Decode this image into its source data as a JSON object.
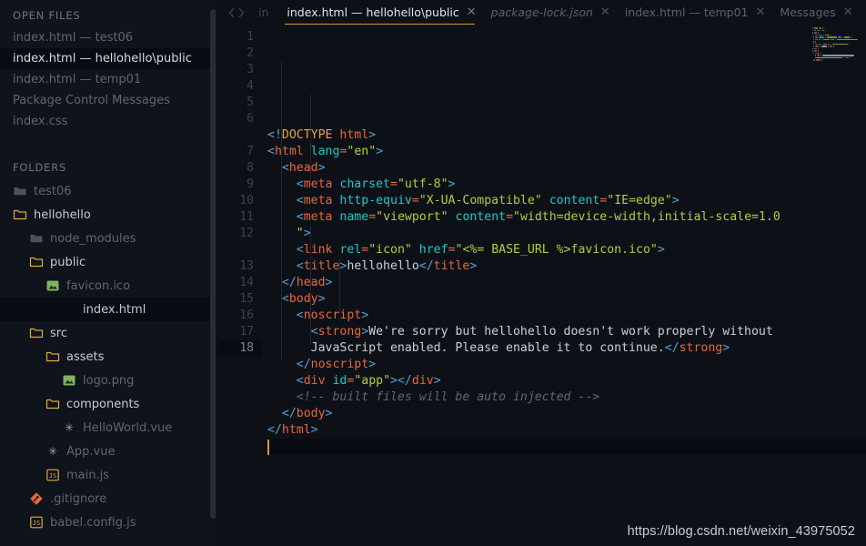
{
  "sidebar": {
    "open_files_header": "OPEN FILES",
    "open_files": [
      {
        "label": "index.html — test06",
        "active": false
      },
      {
        "label": "index.html — hellohello\\public",
        "active": true
      },
      {
        "label": "index.html — temp01",
        "active": false
      },
      {
        "label": "Package Control Messages",
        "active": false
      },
      {
        "label": "index.css",
        "active": false
      }
    ],
    "folders_header": "FOLDERS",
    "tree": [
      {
        "label": "test06",
        "icon": "folder-closed",
        "indent": 0,
        "active": false,
        "lit": false
      },
      {
        "label": "hellohello",
        "icon": "folder-open",
        "indent": 0,
        "active": false,
        "lit": true
      },
      {
        "label": "node_modules",
        "icon": "folder-closed",
        "indent": 1,
        "active": false,
        "lit": false
      },
      {
        "label": "public",
        "icon": "folder-open",
        "indent": 1,
        "active": false,
        "lit": true
      },
      {
        "label": "favicon.ico",
        "icon": "image",
        "indent": 2,
        "active": false,
        "lit": false
      },
      {
        "label": "index.html",
        "icon": "none",
        "indent": 3,
        "active": true,
        "lit": true
      },
      {
        "label": "src",
        "icon": "folder-open",
        "indent": 1,
        "active": false,
        "lit": true
      },
      {
        "label": "assets",
        "icon": "folder-open",
        "indent": 2,
        "active": false,
        "lit": true
      },
      {
        "label": "logo.png",
        "icon": "image",
        "indent": 3,
        "active": false,
        "lit": false
      },
      {
        "label": "components",
        "icon": "folder-open",
        "indent": 2,
        "active": false,
        "lit": true
      },
      {
        "label": "HelloWorld.vue",
        "icon": "vue",
        "indent": 3,
        "active": false,
        "lit": false
      },
      {
        "label": "App.vue",
        "icon": "vue",
        "indent": 2,
        "active": false,
        "lit": false
      },
      {
        "label": "main.js",
        "icon": "js",
        "indent": 2,
        "active": false,
        "lit": false
      },
      {
        "label": ".gitignore",
        "icon": "git",
        "indent": 1,
        "active": false,
        "lit": false
      },
      {
        "label": "babel.config.js",
        "icon": "js",
        "indent": 1,
        "active": false,
        "lit": false
      }
    ]
  },
  "tabbar": {
    "back_icon": "chevron-left-icon",
    "forward_icon": "chevron-right-icon",
    "in_label": "in",
    "close_glyph": "✕",
    "menu_glyph": "⌄",
    "tabs": [
      {
        "label": "index.html — hellohello\\public",
        "active": true,
        "italic": false
      },
      {
        "label": "package-lock.json",
        "active": false,
        "italic": true
      },
      {
        "label": "index.html — temp01",
        "active": false,
        "italic": false
      },
      {
        "label": "Messages",
        "active": false,
        "italic": false
      }
    ]
  },
  "editor": {
    "line_numbers": [
      "1",
      "2",
      "3",
      "4",
      "5",
      "6",
      "",
      "7",
      "8",
      "9",
      "10",
      "11",
      "12",
      "",
      "13",
      "14",
      "15",
      "16",
      "17",
      "18"
    ],
    "current_line_index": 19,
    "cursor_visible": true,
    "lines": [
      {
        "wrapped": false,
        "tokens": [
          {
            "t": "<!",
            "c": "p"
          },
          {
            "t": "DOCTYPE",
            "c": "dt"
          },
          {
            "t": " html",
            "c": "tg"
          },
          {
            "t": ">",
            "c": "p"
          }
        ]
      },
      {
        "wrapped": false,
        "tokens": [
          {
            "t": "<",
            "c": "p"
          },
          {
            "t": "html",
            "c": "tg"
          },
          {
            "t": " ",
            "c": "tx"
          },
          {
            "t": "lang",
            "c": "at"
          },
          {
            "t": "=",
            "c": "eq"
          },
          {
            "t": "\"en\"",
            "c": "st"
          },
          {
            "t": ">",
            "c": "p"
          }
        ]
      },
      {
        "wrapped": false,
        "tokens": [
          {
            "t": "  <",
            "c": "p"
          },
          {
            "t": "head",
            "c": "tg"
          },
          {
            "t": ">",
            "c": "p"
          }
        ]
      },
      {
        "wrapped": false,
        "tokens": [
          {
            "t": "    <",
            "c": "p"
          },
          {
            "t": "meta",
            "c": "tg"
          },
          {
            "t": " ",
            "c": "tx"
          },
          {
            "t": "charset",
            "c": "at"
          },
          {
            "t": "=",
            "c": "eq"
          },
          {
            "t": "\"utf-8\"",
            "c": "st"
          },
          {
            "t": ">",
            "c": "p"
          }
        ]
      },
      {
        "wrapped": false,
        "tokens": [
          {
            "t": "    <",
            "c": "p"
          },
          {
            "t": "meta",
            "c": "tg"
          },
          {
            "t": " ",
            "c": "tx"
          },
          {
            "t": "http-equiv",
            "c": "at"
          },
          {
            "t": "=",
            "c": "eq"
          },
          {
            "t": "\"X-UA-Compatible\"",
            "c": "st"
          },
          {
            "t": " ",
            "c": "tx"
          },
          {
            "t": "content",
            "c": "at"
          },
          {
            "t": "=",
            "c": "eq"
          },
          {
            "t": "\"IE=edge\"",
            "c": "st"
          },
          {
            "t": ">",
            "c": "p"
          }
        ]
      },
      {
        "wrapped": false,
        "tokens": [
          {
            "t": "    <",
            "c": "p"
          },
          {
            "t": "meta",
            "c": "tg"
          },
          {
            "t": " ",
            "c": "tx"
          },
          {
            "t": "name",
            "c": "at"
          },
          {
            "t": "=",
            "c": "eq"
          },
          {
            "t": "\"viewport\"",
            "c": "st"
          },
          {
            "t": " ",
            "c": "tx"
          },
          {
            "t": "content",
            "c": "at"
          },
          {
            "t": "=",
            "c": "eq"
          },
          {
            "t": "\"width=device-width,initial-scale=1.0",
            "c": "st"
          }
        ]
      },
      {
        "wrapped": true,
        "tokens": [
          {
            "t": "    \"",
            "c": "st"
          },
          {
            "t": ">",
            "c": "p"
          }
        ]
      },
      {
        "wrapped": false,
        "tokens": [
          {
            "t": "    <",
            "c": "p"
          },
          {
            "t": "link",
            "c": "tg"
          },
          {
            "t": " ",
            "c": "tx"
          },
          {
            "t": "rel",
            "c": "at"
          },
          {
            "t": "=",
            "c": "eq"
          },
          {
            "t": "\"icon\"",
            "c": "st"
          },
          {
            "t": " ",
            "c": "tx"
          },
          {
            "t": "href",
            "c": "at"
          },
          {
            "t": "=",
            "c": "eq"
          },
          {
            "t": "\"<%= BASE_URL %>favicon.ico\"",
            "c": "st"
          },
          {
            "t": ">",
            "c": "p"
          }
        ]
      },
      {
        "wrapped": false,
        "tokens": [
          {
            "t": "    <",
            "c": "p"
          },
          {
            "t": "title",
            "c": "tg"
          },
          {
            "t": ">",
            "c": "p"
          },
          {
            "t": "hellohello",
            "c": "tx"
          },
          {
            "t": "</",
            "c": "p"
          },
          {
            "t": "title",
            "c": "tg"
          },
          {
            "t": ">",
            "c": "p"
          }
        ]
      },
      {
        "wrapped": false,
        "tokens": [
          {
            "t": "  </",
            "c": "p"
          },
          {
            "t": "head",
            "c": "tg"
          },
          {
            "t": ">",
            "c": "p"
          }
        ]
      },
      {
        "wrapped": false,
        "tokens": [
          {
            "t": "  <",
            "c": "p"
          },
          {
            "t": "body",
            "c": "tg"
          },
          {
            "t": ">",
            "c": "p"
          }
        ]
      },
      {
        "wrapped": false,
        "tokens": [
          {
            "t": "    <",
            "c": "p"
          },
          {
            "t": "noscript",
            "c": "tg"
          },
          {
            "t": ">",
            "c": "p"
          }
        ]
      },
      {
        "wrapped": false,
        "tokens": [
          {
            "t": "      <",
            "c": "p"
          },
          {
            "t": "strong",
            "c": "tg"
          },
          {
            "t": ">",
            "c": "p"
          },
          {
            "t": "We're sorry but hellohello doesn't work properly without",
            "c": "tx"
          }
        ]
      },
      {
        "wrapped": true,
        "tokens": [
          {
            "t": "      JavaScript enabled. Please enable it to continue.",
            "c": "tx"
          },
          {
            "t": "</",
            "c": "p"
          },
          {
            "t": "strong",
            "c": "tg"
          },
          {
            "t": ">",
            "c": "p"
          }
        ]
      },
      {
        "wrapped": false,
        "tokens": [
          {
            "t": "    </",
            "c": "p"
          },
          {
            "t": "noscript",
            "c": "tg"
          },
          {
            "t": ">",
            "c": "p"
          }
        ]
      },
      {
        "wrapped": false,
        "tokens": [
          {
            "t": "    <",
            "c": "p"
          },
          {
            "t": "div",
            "c": "tg"
          },
          {
            "t": " ",
            "c": "tx"
          },
          {
            "t": "id",
            "c": "at"
          },
          {
            "t": "=",
            "c": "eq"
          },
          {
            "t": "\"app\"",
            "c": "st"
          },
          {
            "t": ">",
            "c": "p"
          },
          {
            "t": "</",
            "c": "p"
          },
          {
            "t": "div",
            "c": "tg"
          },
          {
            "t": ">",
            "c": "p"
          }
        ]
      },
      {
        "wrapped": false,
        "tokens": [
          {
            "t": "    <!-- built files will be auto injected -->",
            "c": "cm"
          }
        ]
      },
      {
        "wrapped": false,
        "tokens": [
          {
            "t": "  </",
            "c": "p"
          },
          {
            "t": "body",
            "c": "tg"
          },
          {
            "t": ">",
            "c": "p"
          }
        ]
      },
      {
        "wrapped": false,
        "tokens": [
          {
            "t": "</",
            "c": "p"
          },
          {
            "t": "html",
            "c": "tg"
          },
          {
            "t": ">",
            "c": "p"
          }
        ]
      },
      {
        "wrapped": false,
        "tokens": []
      }
    ],
    "minimap_name": "code-minimap"
  },
  "watermark": {
    "text": "https://blog.csdn.net/weixin_43975052"
  },
  "colors": {
    "background": "#0d1117",
    "sidebar_bg": "#0f131b",
    "accent": "#d39a35",
    "folder": "#e0a93b",
    "tag": "#e8673c",
    "attr": "#1ec8c8",
    "string": "#b5cc3c",
    "punct": "#5a9fd4",
    "comment": "#5c6675"
  }
}
